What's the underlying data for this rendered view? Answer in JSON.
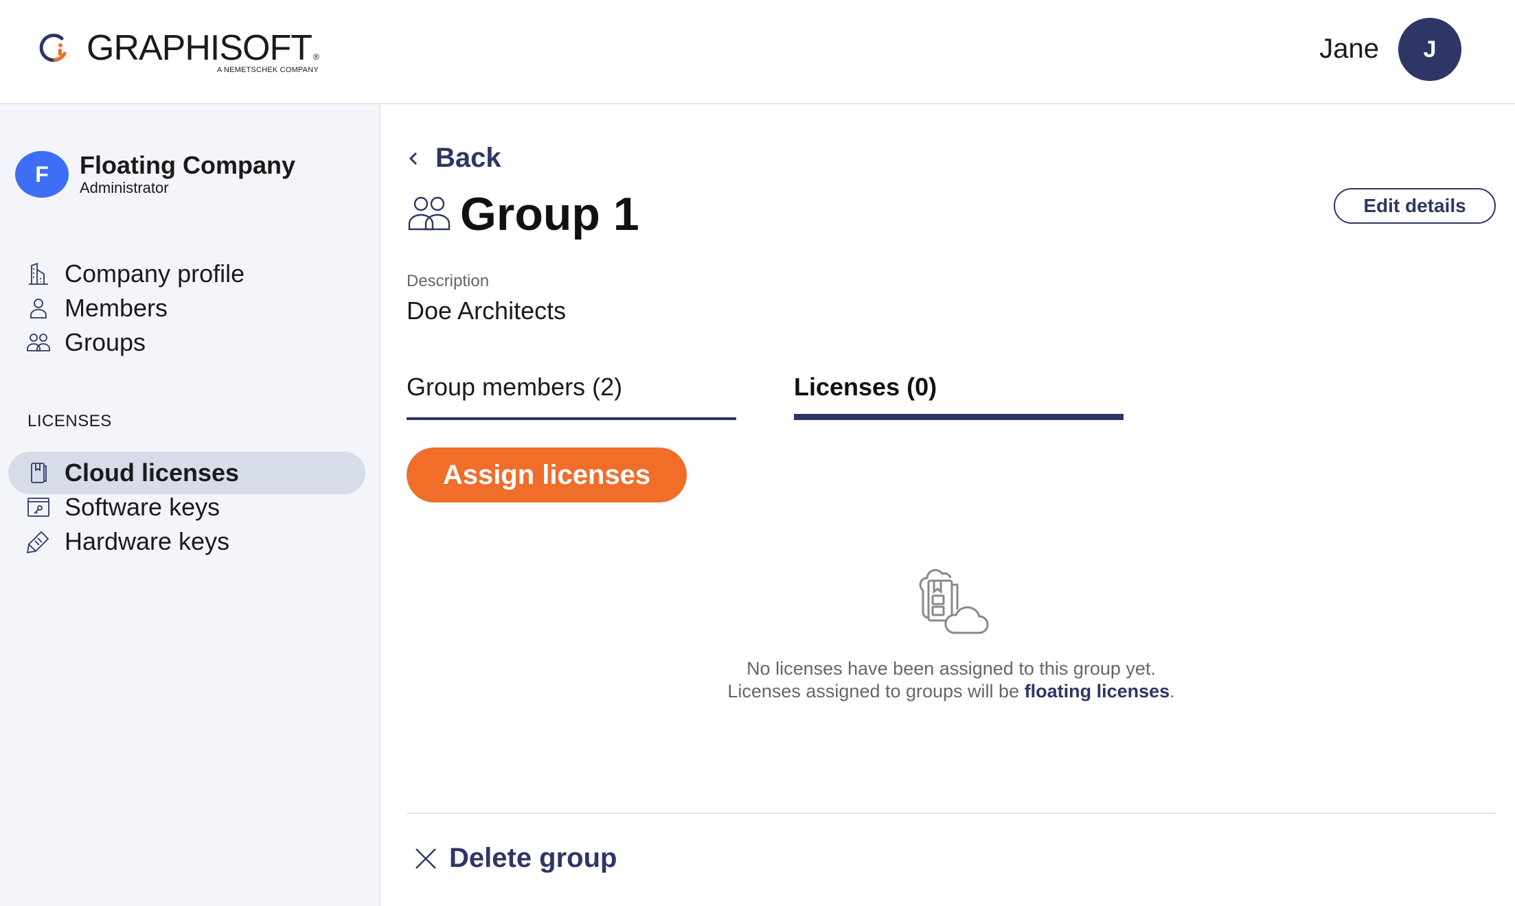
{
  "header": {
    "brand": "GRAPHISOFT",
    "brand_mark": "®",
    "brand_sub": "A NEMETSCHEK COMPANY",
    "user_name": "Jane",
    "user_initial": "J"
  },
  "sidebar": {
    "company_initial": "F",
    "company_name": "Floating Company",
    "company_role": "Administrator",
    "items": [
      {
        "label": "Company profile",
        "icon": "building-icon"
      },
      {
        "label": "Members",
        "icon": "person-icon"
      },
      {
        "label": "Groups",
        "icon": "group-icon"
      }
    ],
    "section_label": "LICENSES",
    "license_items": [
      {
        "label": "Cloud licenses",
        "icon": "cloud-license-icon",
        "active": true
      },
      {
        "label": "Software keys",
        "icon": "software-key-icon"
      },
      {
        "label": "Hardware keys",
        "icon": "hardware-key-icon"
      }
    ]
  },
  "main": {
    "back_label": "Back",
    "title": "Group 1",
    "edit_label": "Edit details",
    "description_label": "Description",
    "description_value": "Doe Architects",
    "tabs": [
      {
        "label": "Group members (2)",
        "active": false
      },
      {
        "label": "Licenses (0)",
        "active": true
      }
    ],
    "assign_label": "Assign licenses",
    "empty": {
      "line1": "No licenses have been assigned to this group yet.",
      "line2_prefix": "Licenses assigned to groups will be ",
      "line2_link": "floating licenses",
      "line2_suffix": "."
    },
    "delete_label": "Delete group"
  },
  "colors": {
    "accent": "#2e3666",
    "orange": "#f06d2a",
    "company_avatar": "#3d6ef5",
    "sidebar_bg": "#f3f5fa",
    "active_item_bg": "#d7dce9"
  }
}
